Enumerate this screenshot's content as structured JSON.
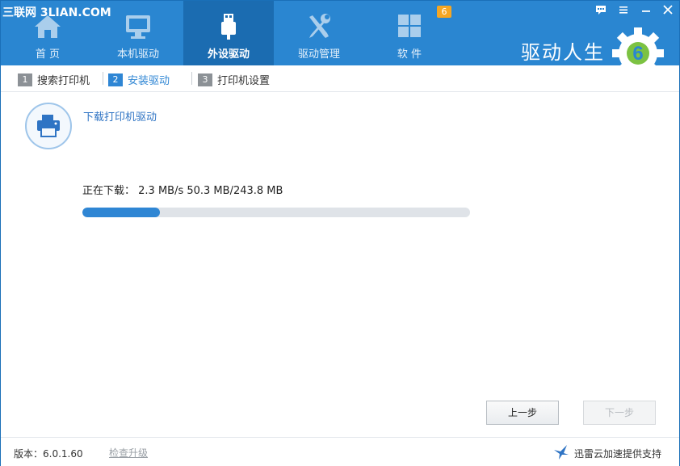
{
  "watermark": "三联网 3LIAN.COM",
  "nav": [
    {
      "label": "首 页",
      "icon": "home-icon"
    },
    {
      "label": "本机驱动",
      "icon": "monitor-icon"
    },
    {
      "label": "外设驱动",
      "icon": "usb-plug-icon",
      "active": true
    },
    {
      "label": "驱动管理",
      "icon": "wrench-screwdriver-icon"
    },
    {
      "label": "软 件",
      "icon": "apps-grid-icon",
      "badge": "6"
    }
  ],
  "brand": {
    "name": "驱动人生",
    "logo_number": "6"
  },
  "window_controls": [
    "message-icon",
    "menu-icon",
    "minimize-icon",
    "close-icon"
  ],
  "steps": [
    {
      "num": "1",
      "label": "搜索打印机"
    },
    {
      "num": "2",
      "label": "安装驱动",
      "active": true
    },
    {
      "num": "3",
      "label": "打印机设置"
    }
  ],
  "task": {
    "title": "下载打印机驱动",
    "status_text": "正在下载： 2.3 MB/s  50.3 MB/243.8 MB",
    "progress_fraction": 0.2
  },
  "buttons": {
    "prev": "上一步",
    "next": "下一步"
  },
  "footer": {
    "version": "版本：6.0.1.60",
    "upgrade": "检查升级",
    "sponsor": "迅雷云加速提供支持"
  },
  "colors": {
    "header": "#2a86d1",
    "active_tab": "#1b6cb1",
    "accent": "#2f86d4",
    "badge": "#f5a623"
  }
}
